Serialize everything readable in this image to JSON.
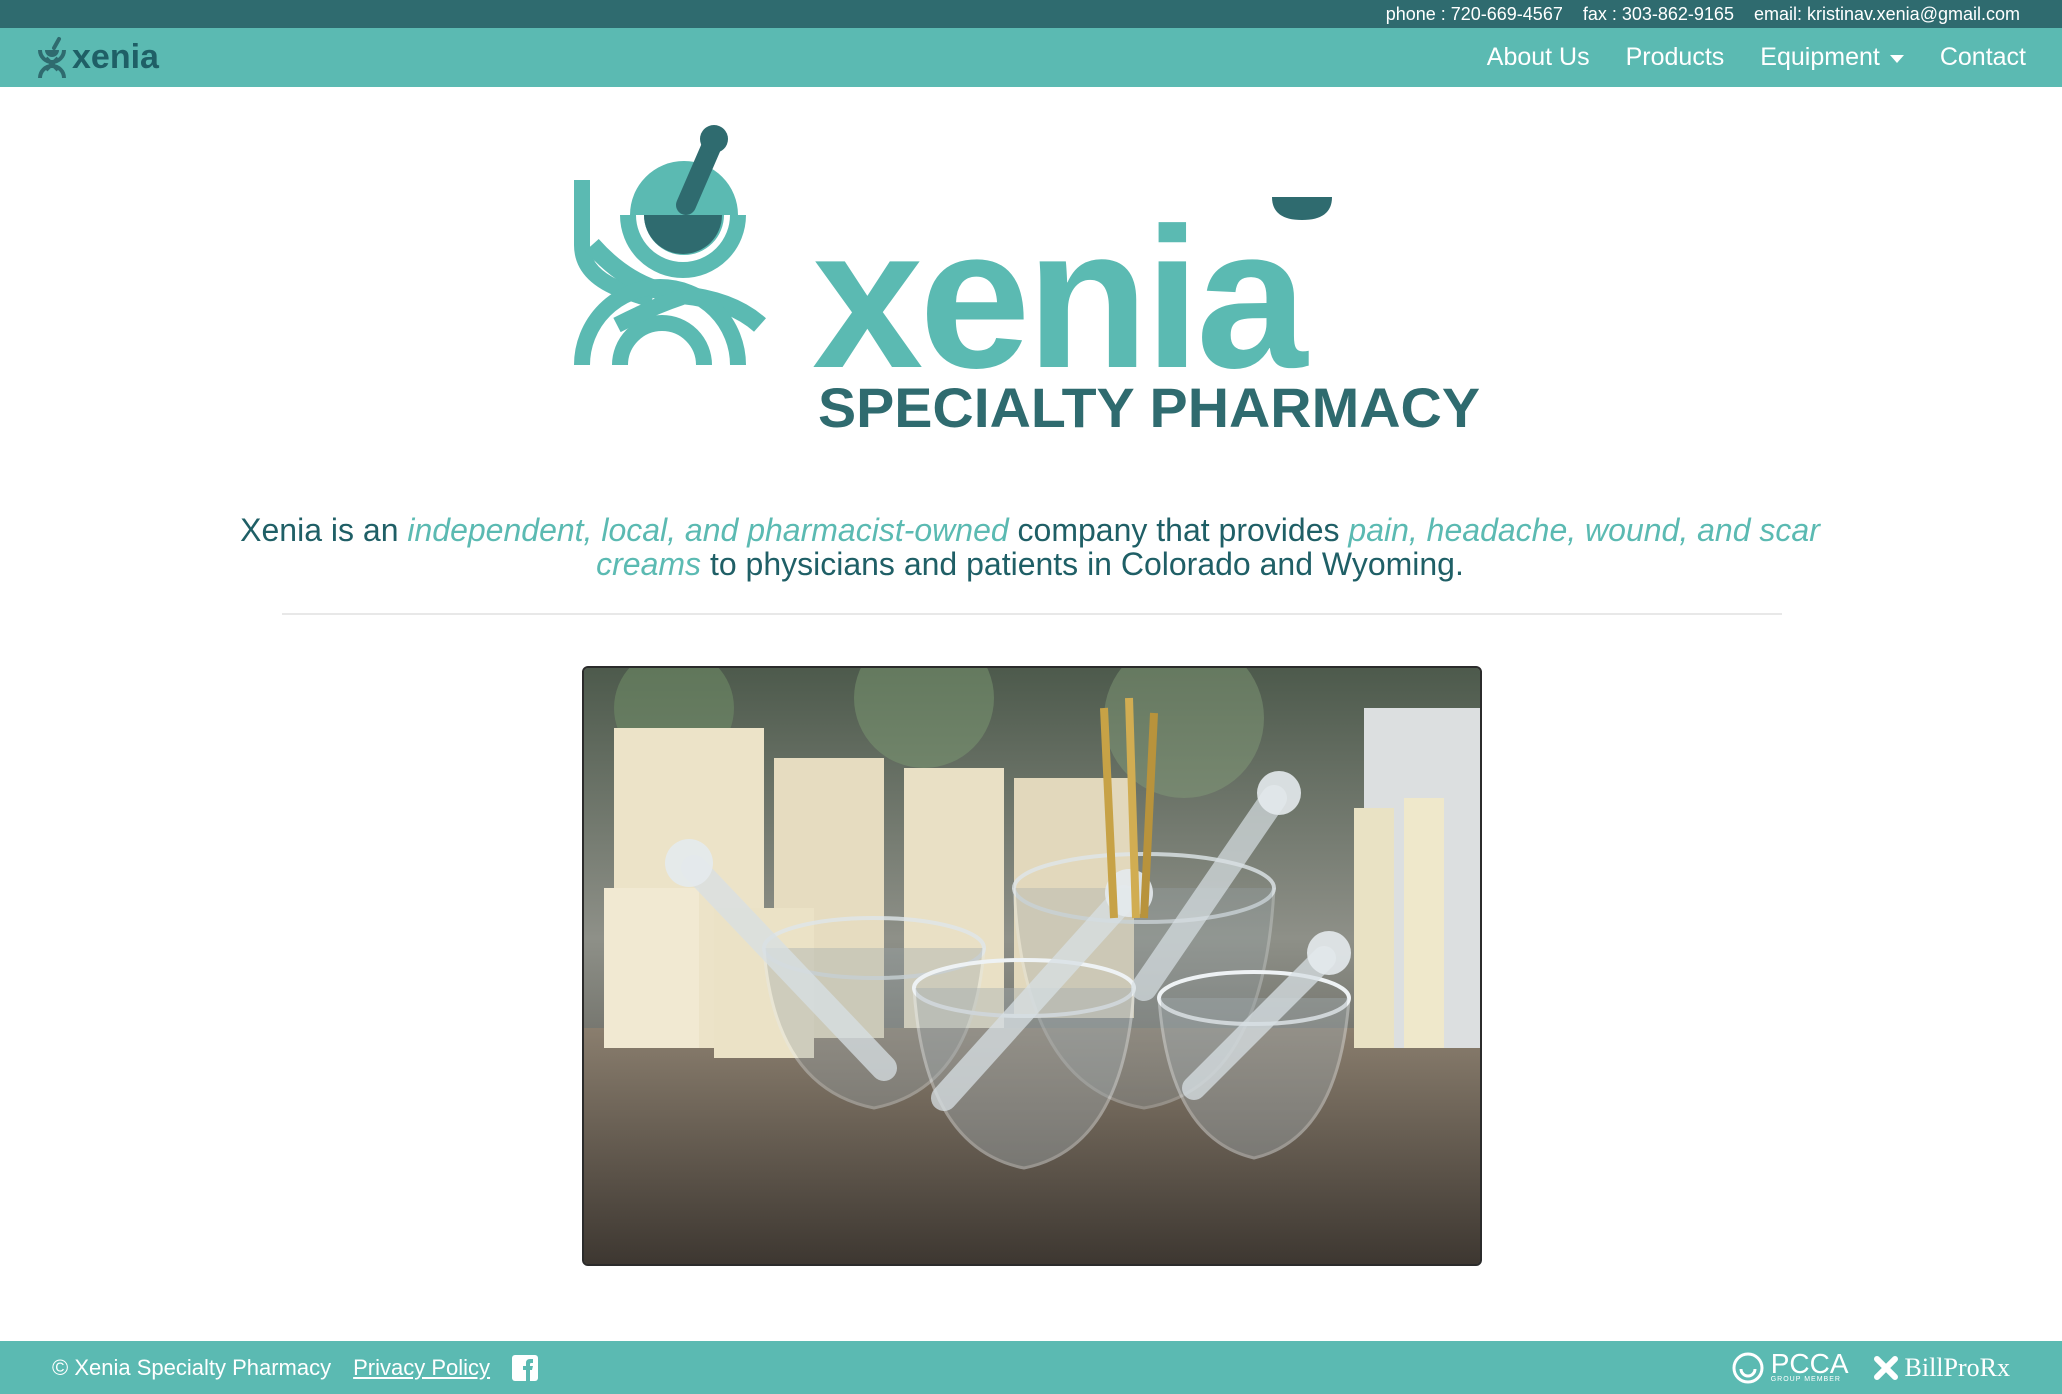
{
  "topbar": {
    "phone": "phone : 720-669-4567",
    "fax": "fax : 303-862-9165",
    "email": "email: kristinav.xenia@gmail.com"
  },
  "navbar": {
    "brand": "xenia",
    "items": [
      {
        "label": "About Us"
      },
      {
        "label": "Products"
      },
      {
        "label": "Equipment"
      },
      {
        "label": "Contact"
      }
    ]
  },
  "hero": {
    "wordmark": "xenia",
    "subtitle": "SPECIALTY PHARMACY"
  },
  "tagline": {
    "part1": "Xenia is an ",
    "highlight1": "independent, local, and pharmacist-owned",
    "part2": " company that provides ",
    "highlight2": "pain, headache, wound, and scar creams",
    "part3": " to physicians and patients in Colorado and Wyoming."
  },
  "footer": {
    "copyright": "© Xenia Specialty Pharmacy",
    "privacy": "Privacy Policy",
    "pcca": "PCCA",
    "pcca_sub": "GROUP MEMBER",
    "billpro": "BillProRx"
  },
  "colors": {
    "teal": "#5bbab2",
    "dark_teal": "#2f6b6f",
    "text": "#1f5f66"
  },
  "icons": [
    "xenia-logo-icon",
    "dropdown-caret-icon",
    "facebook-icon",
    "pcca-icon",
    "billpro-icon"
  ]
}
